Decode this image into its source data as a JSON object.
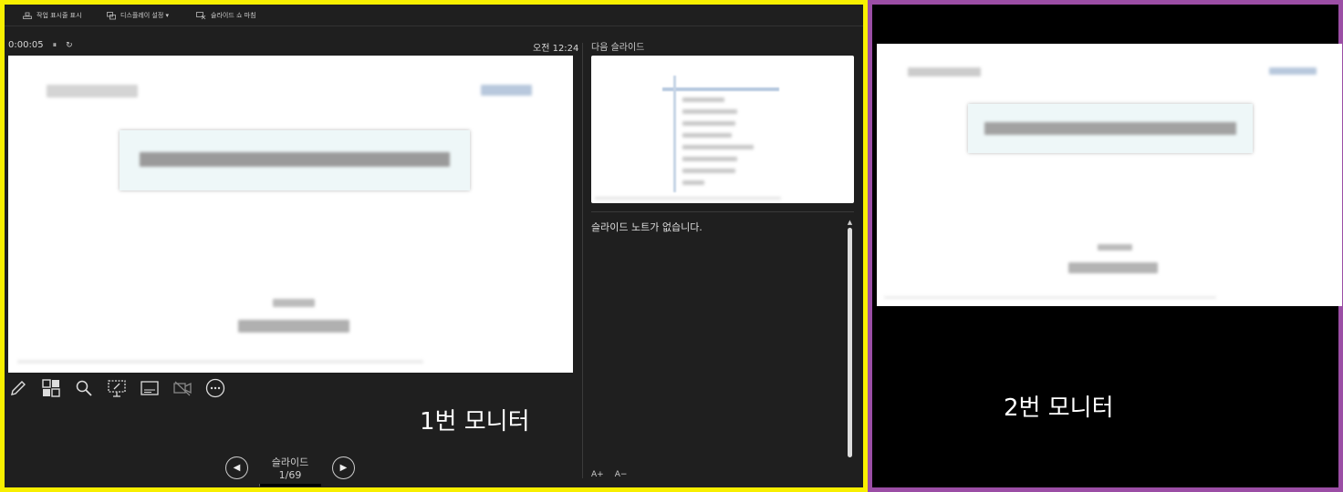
{
  "toolbar": {
    "show_taskbar": "작업 표시줄 표시",
    "display_settings": "디스플레이 설정 ▾",
    "end_show": "슬라이드 쇼 마침"
  },
  "status": {
    "elapsed": "0:00:05",
    "pause_icon": "pause-icon",
    "restart_icon": "restart-icon",
    "clock": "오전 12:24"
  },
  "tools": [
    "pen-icon",
    "slide-sorter-icon",
    "zoom-icon",
    "pointer-screen-icon",
    "subtitles-icon",
    "camera-off-icon",
    "more-options-icon"
  ],
  "labels": {
    "monitor1": "1번 모니터",
    "monitor2": "2번 모니터"
  },
  "navigation": {
    "prev_icon": "◀",
    "next_icon": "▶",
    "counter": "슬라이드 1/69",
    "progress": 0.0145
  },
  "next_slide": {
    "label": "다음 슬라이드"
  },
  "notes": {
    "text": "슬라이드 노트가 없습니다.",
    "increase_font": "A+",
    "decrease_font": "A−"
  },
  "colors": {
    "monitor1_border": "#f8ef00",
    "monitor2_border": "#9b4ea5",
    "panel_bg": "#1f1f1f"
  }
}
